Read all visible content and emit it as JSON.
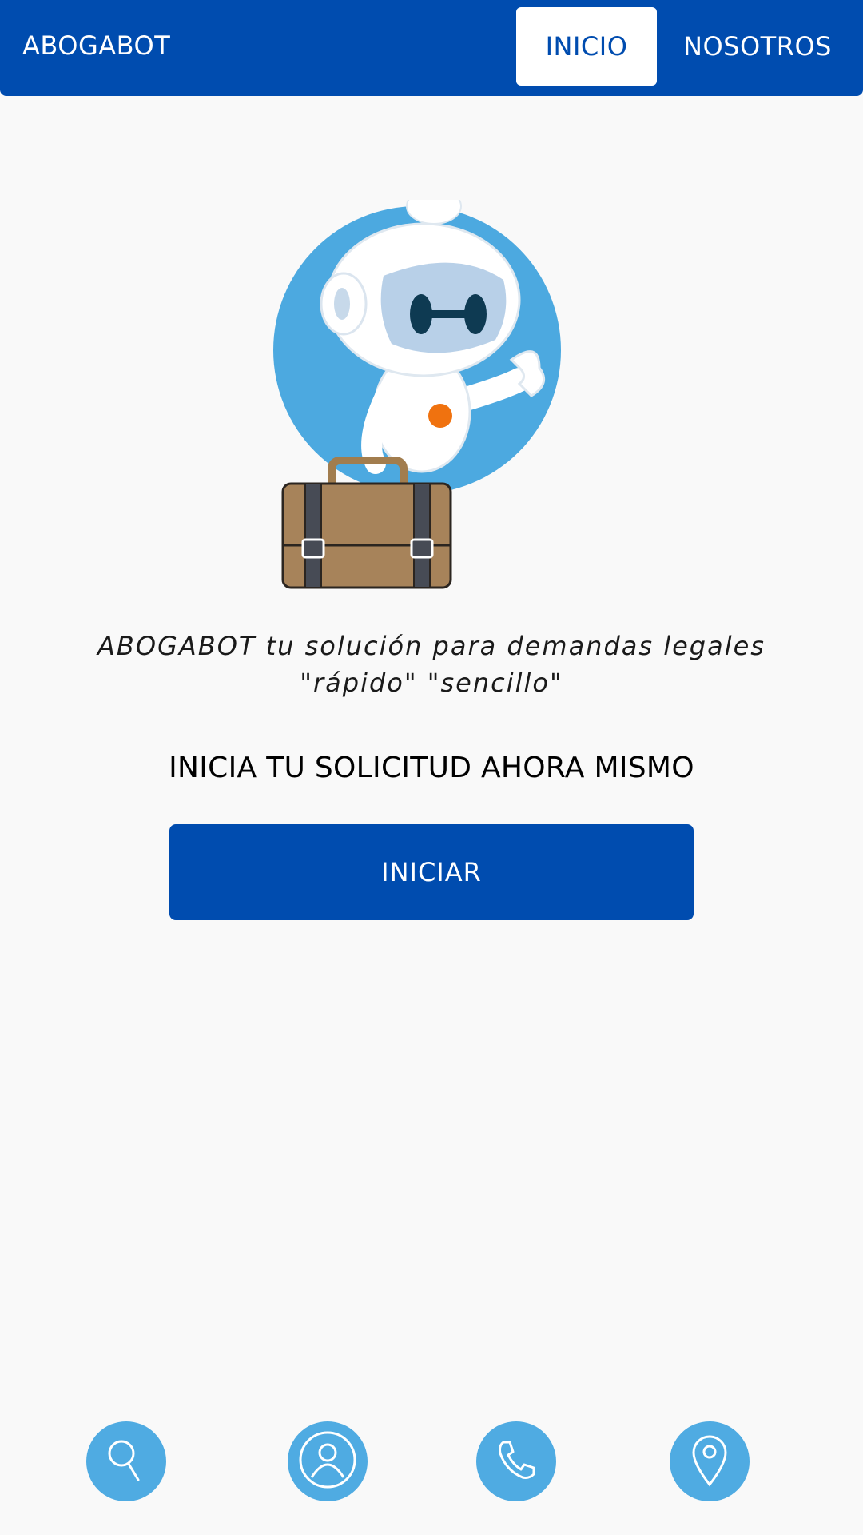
{
  "header": {
    "brand": "ABOGABOT",
    "tabs": [
      {
        "label": "INICIO",
        "active": true
      },
      {
        "label": "NOSOTROS",
        "active": false
      }
    ]
  },
  "main": {
    "tagline_line1": "ABOGABOT tu solución para demandas legales",
    "tagline_line2": "\"rápido\"  \"sencillo\"",
    "cta_heading": "INICIA TU SOLICITUD AHORA MISMO",
    "cta_button": "INICIAR",
    "hero_image": "robot-with-briefcase"
  },
  "bottom_bar": {
    "icons": [
      "search-icon",
      "user-icon",
      "phone-icon",
      "location-pin-icon"
    ]
  },
  "colors": {
    "primary": "#004caf",
    "accent": "#4fabe2",
    "background": "#f9f9f9"
  }
}
